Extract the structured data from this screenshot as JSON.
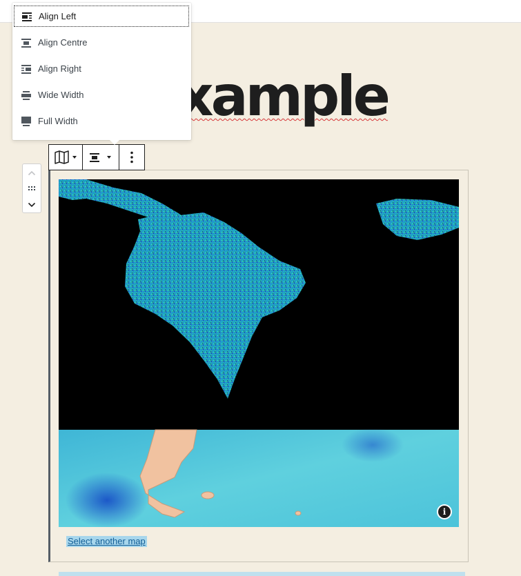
{
  "page": {
    "title_fragment": "xample"
  },
  "align_menu": {
    "items": [
      {
        "label": "Align Left",
        "icon": "align-left-icon",
        "active": true
      },
      {
        "label": "Align Centre",
        "icon": "align-center-icon",
        "active": false
      },
      {
        "label": "Align Right",
        "icon": "align-right-icon",
        "active": false
      },
      {
        "label": "Wide Width",
        "icon": "align-wide-icon",
        "active": false
      },
      {
        "label": "Full Width",
        "icon": "align-full-width-icon",
        "active": false
      }
    ]
  },
  "toolbar": {
    "block_icon": "map-icon",
    "align_icon": "align-center-icon",
    "options_icon": "more-vertical-icon"
  },
  "mover": {
    "up_icon": "chevron-up-icon",
    "drag_icon": "drag-handle-icon",
    "down_icon": "chevron-down-icon"
  },
  "map_block": {
    "info_icon": "info-icon",
    "info_glyph": "i",
    "select_link": "Select another map"
  },
  "colors": {
    "background": "#f4eee1",
    "ocean": "#4fc3d8",
    "link": "#135e96",
    "link_highlight": "#a7d6ec"
  }
}
